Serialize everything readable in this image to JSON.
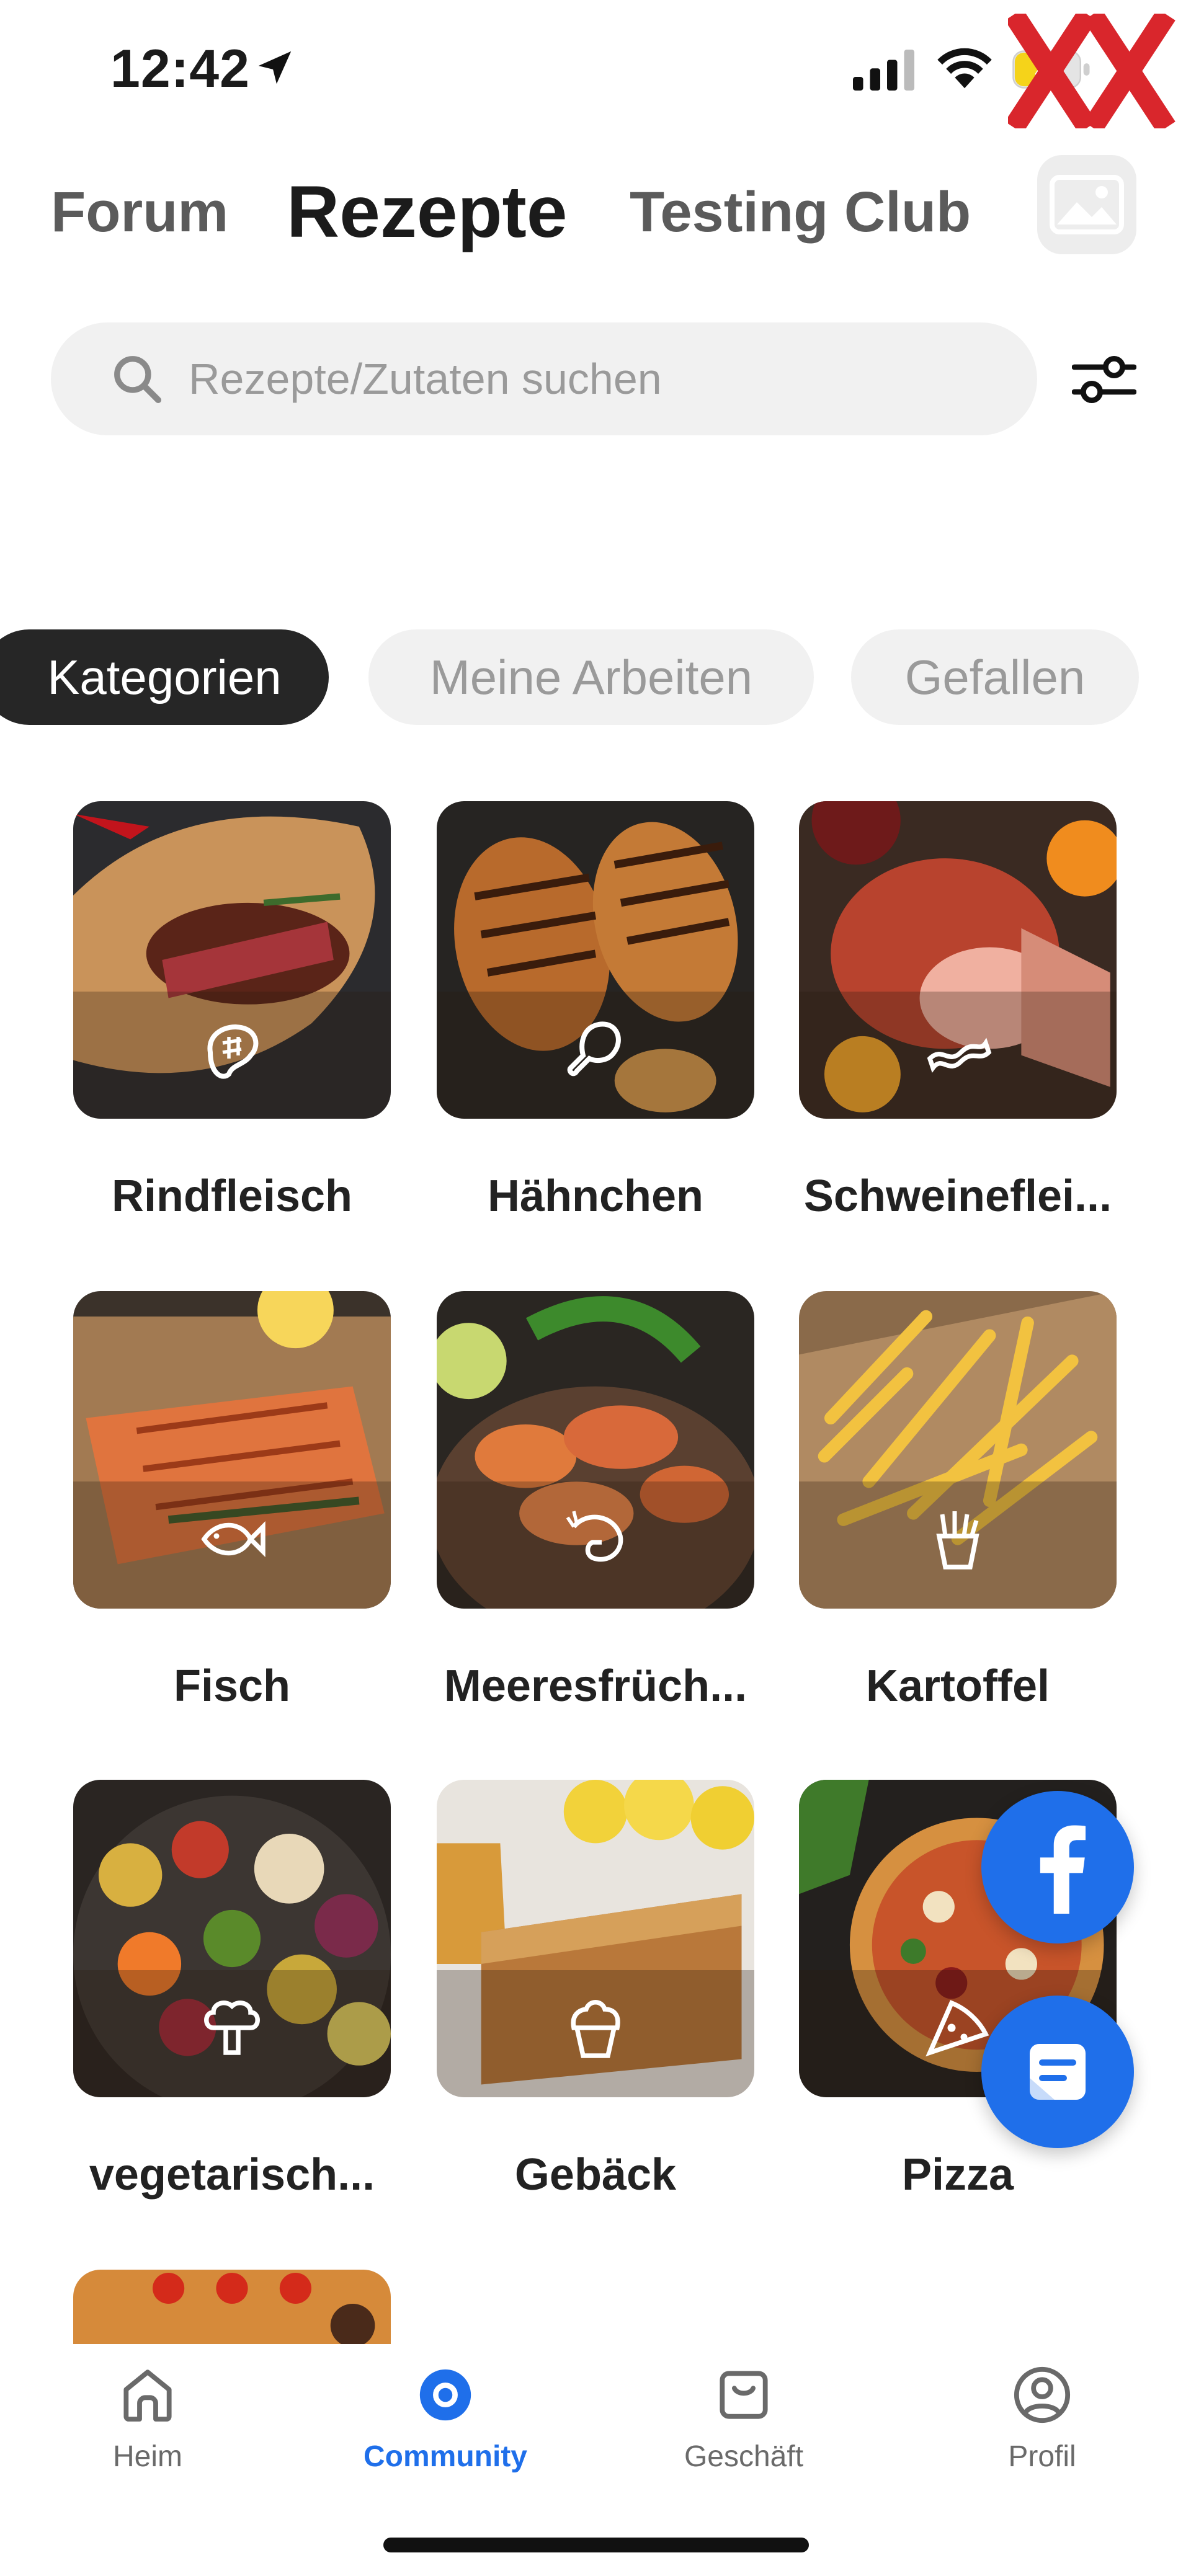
{
  "status_bar": {
    "time": "12:42",
    "battery": "48"
  },
  "top_tabs": {
    "forum": "Forum",
    "rezepte": "Rezepte",
    "testing_club": "Testing Club"
  },
  "search": {
    "placeholder": "Rezepte/Zutaten suchen",
    "value": ""
  },
  "category_tabs": {
    "kategorien": "Kategorien",
    "meine_arbeiten": "Meine Arbeiten",
    "gefallen": "Gefallen"
  },
  "categories": [
    {
      "label": "Rindfleisch",
      "icon": "steak-icon"
    },
    {
      "label": "Hähnchen",
      "icon": "chicken-leg-icon"
    },
    {
      "label": "Schweineflei...",
      "icon": "bacon-icon"
    },
    {
      "label": "Fisch",
      "icon": "fish-icon"
    },
    {
      "label": "Meeresfrüch...",
      "icon": "shrimp-icon"
    },
    {
      "label": "Kartoffel",
      "icon": "fries-icon"
    },
    {
      "label": "vegetarisch...",
      "icon": "broccoli-icon"
    },
    {
      "label": "Gebäck",
      "icon": "cupcake-icon"
    },
    {
      "label": "Pizza",
      "icon": "pizza-slice-icon"
    }
  ],
  "bottom_nav": {
    "heim": "Heim",
    "community": "Community",
    "geschaeft": "Geschäft",
    "profil": "Profil"
  },
  "colors": {
    "accent": "#1f6fea",
    "active_pill": "#262626",
    "pill_inactive": "#f1f1f1",
    "watermark": "#d9262c"
  }
}
